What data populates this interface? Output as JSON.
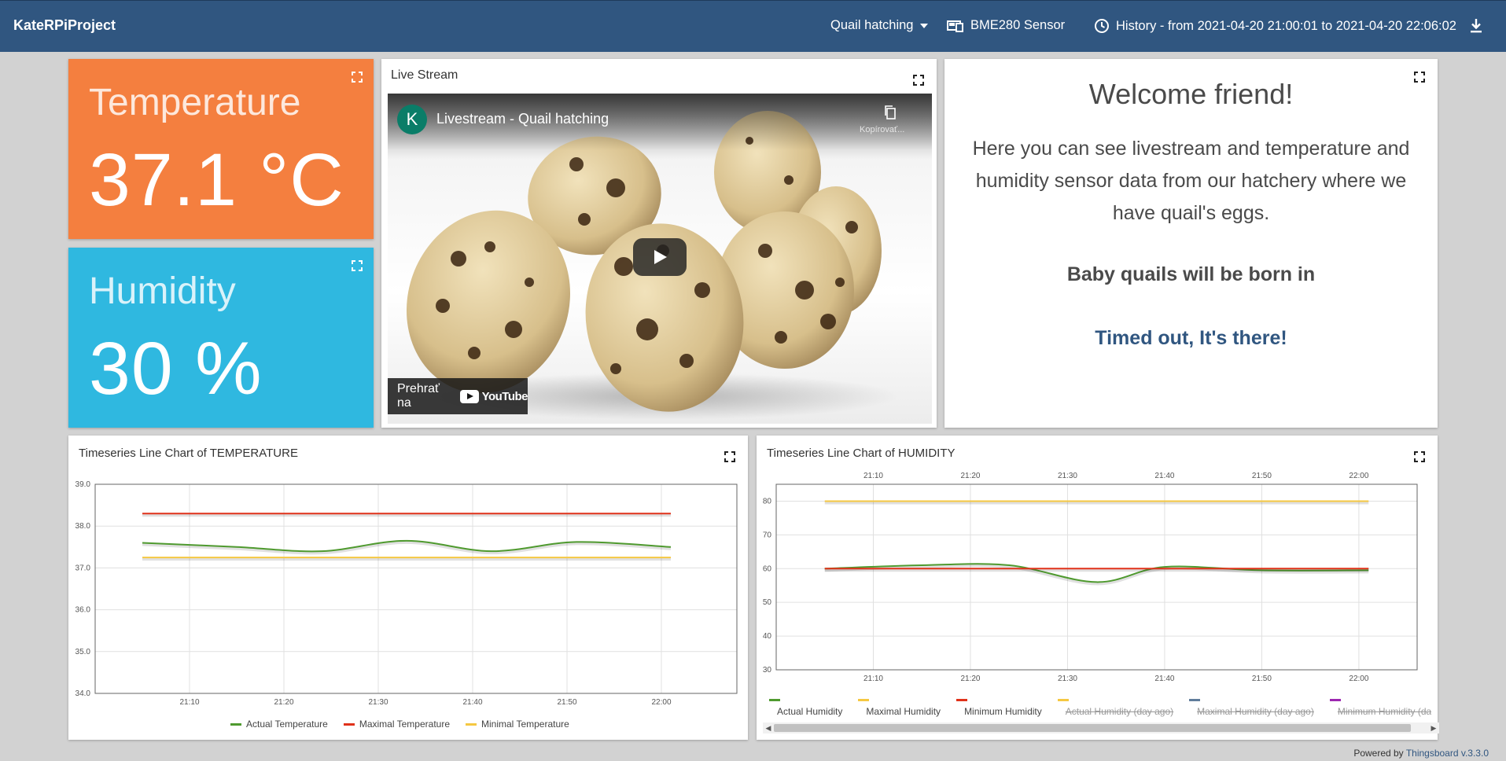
{
  "topbar": {
    "brand": "KateRPiProject",
    "dashboard_select": "Quail hatching",
    "device": "BME280 Sensor",
    "history": "History - from 2021-04-20 21:00:01 to 2021-04-20 22:06:02"
  },
  "temperature_tile": {
    "label": "Temperature",
    "value": "37.1 °C",
    "color": "#f47f3f"
  },
  "humidity_tile": {
    "label": "Humidity",
    "value": "30 %",
    "color": "#2fb8e0"
  },
  "live_stream": {
    "title": "Live Stream",
    "avatar_letter": "K",
    "video_title": "Livestream - Quail hatching",
    "copy_label": "Kopírovať...",
    "watch_on": "Prehrať na",
    "platform": "YouTube"
  },
  "welcome": {
    "title": "Welcome friend!",
    "body": "Here you can see livestream and temperature and humidity sensor data from our hatchery where we have quail's eggs.",
    "countdown_label": "Baby quails will be born in",
    "countdown_value": "Timed out, It's there!"
  },
  "temp_chart": {
    "title": "Timeseries Line Chart of TEMPERATURE",
    "legend": [
      {
        "name": "Actual Temperature",
        "color": "#4f9a2f"
      },
      {
        "name": "Maximal Temperature",
        "color": "#e0321a"
      },
      {
        "name": "Minimal Temperature",
        "color": "#f5c842"
      }
    ]
  },
  "hum_chart": {
    "title": "Timeseries Line Chart of HUMIDITY",
    "legend": [
      {
        "name": "Actual Humidity",
        "color": "#4f9a2f",
        "hidden": false
      },
      {
        "name": "Maximal Humidity",
        "color": "#f5c842",
        "hidden": false
      },
      {
        "name": "Minimum Humidity",
        "color": "#e0321a",
        "hidden": false
      },
      {
        "name": "Actual Humidity (day ago)",
        "color": "#f5c842",
        "hidden": true
      },
      {
        "name": "Maximal Humidity (day ago)",
        "color": "#607d9b",
        "hidden": true
      },
      {
        "name": "Minimum Humidity (day a",
        "color": "#9c27b0",
        "hidden": true
      }
    ]
  },
  "chart_data": [
    {
      "type": "line",
      "title": "Timeseries Line Chart of TEMPERATURE",
      "x_ticks": [
        "21:10",
        "21:20",
        "21:30",
        "21:40",
        "21:50",
        "22:00"
      ],
      "y_ticks": [
        "34.0",
        "35.0",
        "36.0",
        "37.0",
        "38.0",
        "39.0"
      ],
      "ylim": [
        34,
        39
      ],
      "xlim": [
        "21:00",
        "22:08"
      ],
      "grid": true,
      "legend_position": "bottom",
      "series": [
        {
          "name": "Actual Temperature",
          "color": "#4f9a2f",
          "x": [
            "21:05",
            "21:15",
            "21:24",
            "21:33",
            "21:42",
            "21:51",
            "22:01"
          ],
          "values": [
            37.6,
            37.5,
            37.4,
            37.65,
            37.4,
            37.62,
            37.5
          ]
        },
        {
          "name": "Maximal Temperature",
          "color": "#e0321a",
          "x": [
            "21:05",
            "22:01"
          ],
          "values": [
            38.3,
            38.3
          ]
        },
        {
          "name": "Minimal Temperature",
          "color": "#f5c842",
          "x": [
            "21:05",
            "22:01"
          ],
          "values": [
            37.25,
            37.25
          ]
        }
      ]
    },
    {
      "type": "line",
      "title": "Timeseries Line Chart of HUMIDITY",
      "x_ticks": [
        "21:10",
        "21:20",
        "21:30",
        "21:40",
        "21:50",
        "22:00"
      ],
      "y_ticks": [
        "30",
        "40",
        "50",
        "60",
        "70",
        "80"
      ],
      "ylim": [
        30,
        85
      ],
      "xlim": [
        "21:00",
        "22:06"
      ],
      "grid": true,
      "legend_position": "bottom",
      "series": [
        {
          "name": "Actual Humidity",
          "color": "#4f9a2f",
          "x": [
            "21:05",
            "21:15",
            "21:24",
            "21:33",
            "21:40",
            "21:50",
            "22:01"
          ],
          "values": [
            60,
            61,
            61,
            56,
            60.5,
            59.5,
            59.5
          ]
        },
        {
          "name": "Maximal Humidity",
          "color": "#f5c842",
          "x": [
            "21:05",
            "22:01"
          ],
          "values": [
            80,
            80
          ]
        },
        {
          "name": "Minimum Humidity",
          "color": "#e0321a",
          "x": [
            "21:05",
            "22:01"
          ],
          "values": [
            60,
            60
          ]
        }
      ]
    }
  ],
  "footer": {
    "prefix": "Powered by",
    "link": "Thingsboard v.3.3.0"
  }
}
